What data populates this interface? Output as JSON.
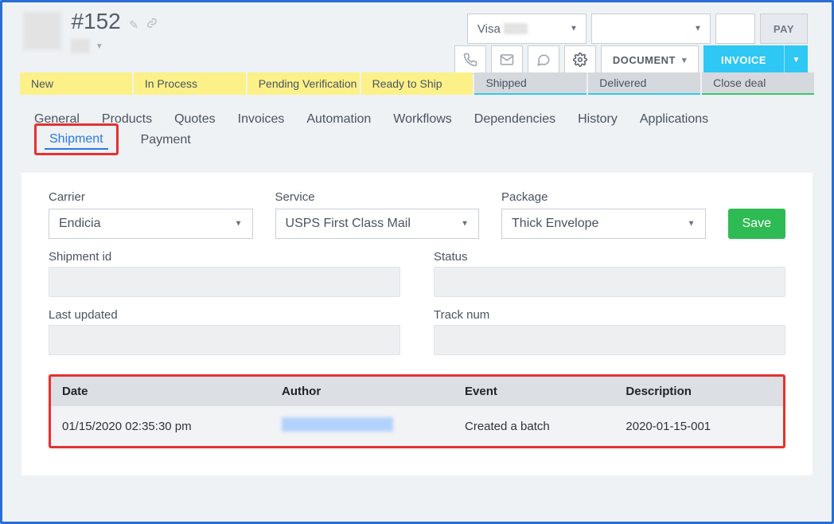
{
  "order": {
    "title": "#152"
  },
  "paybar": {
    "card_selected": "Visa",
    "blank_selected": "",
    "amount": "",
    "pay_label": "PAY"
  },
  "actions": {
    "document_label": "DOCUMENT",
    "invoice_label": "INVOICE"
  },
  "stages": [
    {
      "label": "New",
      "cls": "yellow"
    },
    {
      "label": "In Process",
      "cls": "yellow"
    },
    {
      "label": "Pending Verification",
      "cls": "yellow"
    },
    {
      "label": "Ready to Ship",
      "cls": "yellow"
    },
    {
      "label": "Shipped",
      "cls": "gray"
    },
    {
      "label": "Delivered",
      "cls": "gray"
    },
    {
      "label": "Close deal",
      "cls": "green"
    }
  ],
  "tabs": [
    "General",
    "Products",
    "Quotes",
    "Invoices",
    "Automation",
    "Workflows",
    "Dependencies",
    "History",
    "Applications",
    "Shipment",
    "Payment"
  ],
  "active_tab": "Shipment",
  "shipment": {
    "carrier_label": "Carrier",
    "carrier_value": "Endicia",
    "service_label": "Service",
    "service_value": "USPS First Class Mail",
    "package_label": "Package",
    "package_value": "Thick Envelope",
    "save_label": "Save",
    "shipid_label": "Shipment id",
    "shipid_value": "",
    "status_label": "Status",
    "status_value": "",
    "lastupd_label": "Last updated",
    "lastupd_value": "",
    "track_label": "Track num",
    "track_value": ""
  },
  "log": {
    "headers": {
      "date": "Date",
      "author": "Author",
      "event": "Event",
      "desc": "Description"
    },
    "rows": [
      {
        "date": "01/15/2020 02:35:30 pm",
        "author": "",
        "event": "Created a batch",
        "desc": "2020-01-15-001"
      }
    ]
  }
}
